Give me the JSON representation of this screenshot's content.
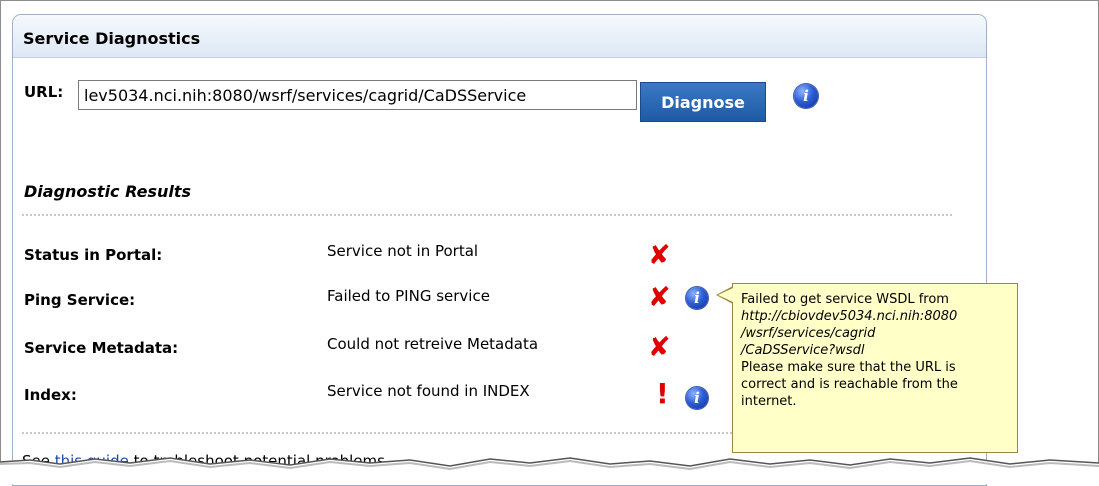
{
  "panel": {
    "title": "Service Diagnostics"
  },
  "url": {
    "label": "URL:",
    "value": "lev5034.nci.nih:8080/wsrf/services/cagrid/CaDSService",
    "button": "Diagnose"
  },
  "results": {
    "title": "Diagnostic Results",
    "rows": [
      {
        "label": "Status in Portal:",
        "value": "Service not in Portal",
        "status": "fail-x"
      },
      {
        "label": "Ping Service:",
        "value": "Failed to PING service",
        "status": "fail-x",
        "info": true
      },
      {
        "label": "Service Metadata:",
        "value": "Could not retreive Metadata",
        "status": "fail-x"
      },
      {
        "label": "Index:",
        "value": "Service not found in INDEX",
        "status": "warn-bang",
        "info": true
      }
    ]
  },
  "tooltip": {
    "line1": "Failed to get service WSDL from",
    "url1": "http://cbiovdev5034.nci.nih:8080",
    "url2": "/wsrf/services/cagrid",
    "url3": "/CaDSService?wsdl",
    "line2": "Please make sure that the URL is",
    "line3": "correct and is reachable from the",
    "line4": "internet."
  },
  "footer": {
    "prefix": "See ",
    "link": "this guide",
    "suffix": " to trobleshoot potential problems"
  },
  "icons": {
    "info": "info-icon",
    "fail": "red-x-icon",
    "warn": "exclamation-icon"
  },
  "colors": {
    "button": "#2a66b4",
    "fail": "#e00000",
    "tooltip_bg": "#ffffc8",
    "link": "#1a4aa8"
  }
}
